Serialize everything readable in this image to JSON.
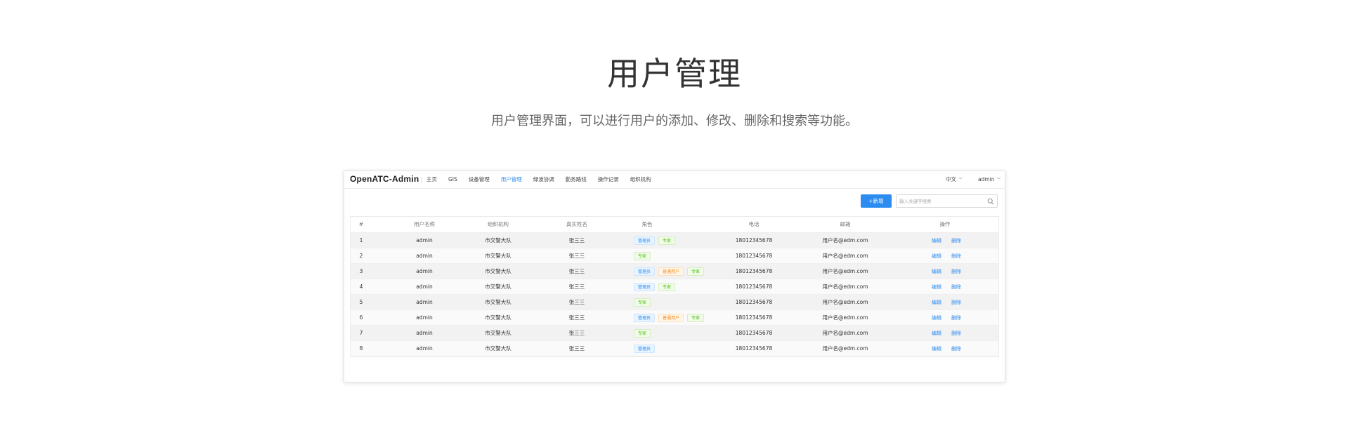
{
  "hero": {
    "title": "用户管理",
    "subtitle": "用户管理界面，可以进行用户的添加、修改、删除和搜索等功能。"
  },
  "app": {
    "brand": "OpenATC-Admin",
    "nav": [
      "主页",
      "GIS",
      "设备管理",
      "用户管理",
      "绿波协调",
      "勤务路线",
      "操作记录",
      "组织机构"
    ],
    "active_nav": "用户管理",
    "language": "中文",
    "user": "admin"
  },
  "toolbar": {
    "add_label": "+新增",
    "search_placeholder": "输入关键字搜索",
    "search_value": ""
  },
  "table": {
    "headers": [
      "#",
      "用户名称",
      "组织机构",
      "真实姓名",
      "角色",
      "电话",
      "邮箱",
      "操作"
    ],
    "rows": [
      {
        "idx": "1",
        "username": "admin",
        "org": "市交警大队",
        "realname": "张三三",
        "roles": [
          "管理员",
          "专家"
        ],
        "phone": "18012345678",
        "email": "用户名@edm.com"
      },
      {
        "idx": "2",
        "username": "admin",
        "org": "市交警大队",
        "realname": "张三三",
        "roles": [
          "专家"
        ],
        "phone": "18012345678",
        "email": "用户名@edm.com"
      },
      {
        "idx": "3",
        "username": "admin",
        "org": "市交警大队",
        "realname": "张三三",
        "roles": [
          "管理员",
          "普通用户",
          "专家"
        ],
        "phone": "18012345678",
        "email": "用户名@edm.com"
      },
      {
        "idx": "4",
        "username": "admin",
        "org": "市交警大队",
        "realname": "张三三",
        "roles": [
          "管理员",
          "专家"
        ],
        "phone": "18012345678",
        "email": "用户名@edm.com"
      },
      {
        "idx": "5",
        "username": "admin",
        "org": "市交警大队",
        "realname": "张三三",
        "roles": [
          "专家"
        ],
        "phone": "18012345678",
        "email": "用户名@edm.com"
      },
      {
        "idx": "6",
        "username": "admin",
        "org": "市交警大队",
        "realname": "张三三",
        "roles": [
          "管理员",
          "普通用户",
          "专家"
        ],
        "phone": "18012345678",
        "email": "用户名@edm.com"
      },
      {
        "idx": "7",
        "username": "admin",
        "org": "市交警大队",
        "realname": "张三三",
        "roles": [
          "专家"
        ],
        "phone": "18012345678",
        "email": "用户名@edm.com"
      },
      {
        "idx": "8",
        "username": "admin",
        "org": "市交警大队",
        "realname": "张三三",
        "roles": [
          "管理员"
        ],
        "phone": "18012345678",
        "email": "用户名@edm.com"
      }
    ],
    "actions": {
      "edit": "编辑",
      "delete": "删除"
    }
  },
  "role_colors": {
    "管理员": "#2d8cf0",
    "专家": "#52c41a",
    "普通用户": "#fa8c16"
  },
  "accent_color": "#2d8cf0"
}
